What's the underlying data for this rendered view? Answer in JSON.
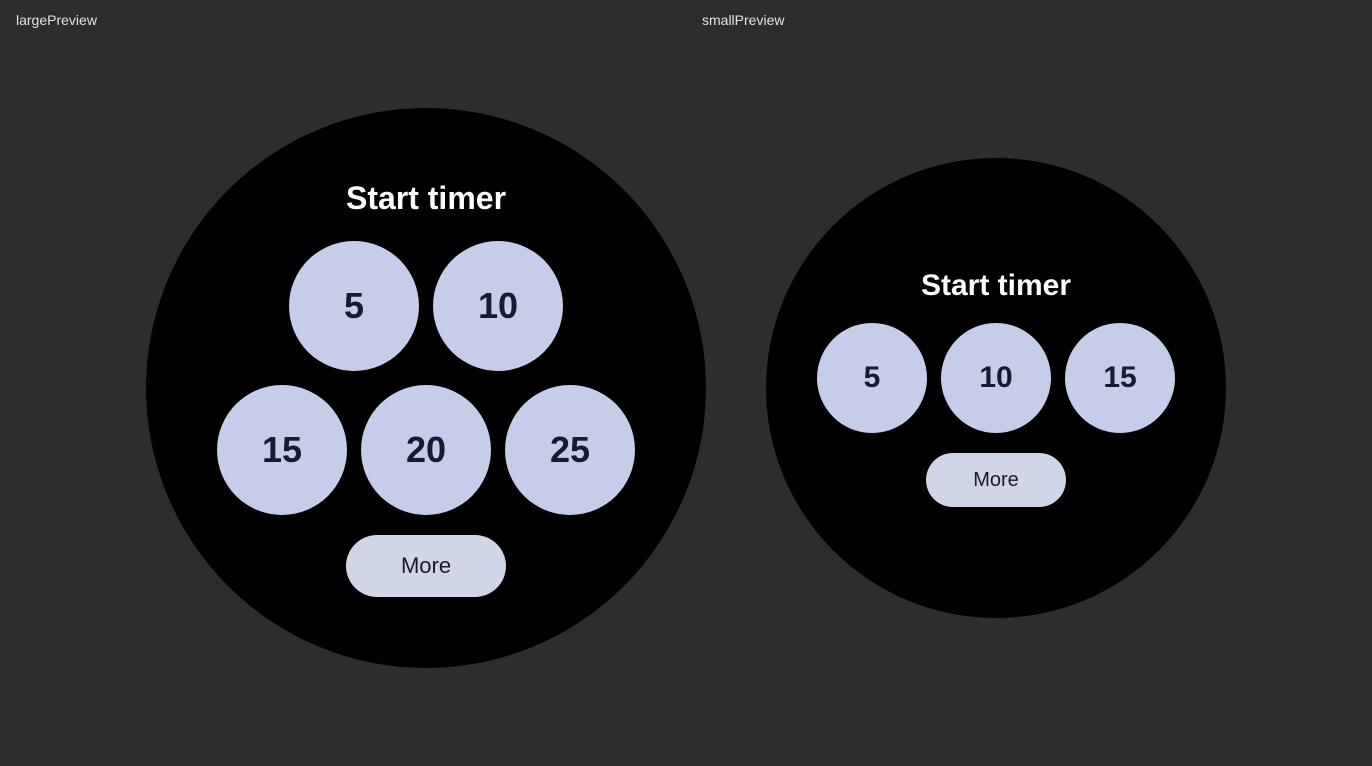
{
  "labels": {
    "large": "largePreview",
    "small": "smallPreview"
  },
  "large_preview": {
    "title": "Start timer",
    "row1": [
      "5",
      "10"
    ],
    "row2": [
      "15",
      "20",
      "25"
    ],
    "more_label": "More"
  },
  "small_preview": {
    "title": "Start timer",
    "row1": [
      "5",
      "10",
      "15"
    ],
    "more_label": "More"
  },
  "colors": {
    "background": "#2d2d2d",
    "watch_face": "#000000",
    "button_bg": "#c5cde8",
    "more_bg": "#d0d5e8",
    "text_white": "#ffffff",
    "text_dark": "#1a1a2e",
    "label_color": "#e0e0e0"
  }
}
